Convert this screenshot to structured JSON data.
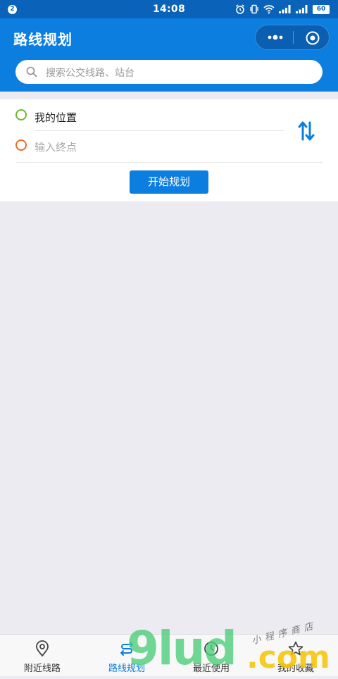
{
  "status_bar": {
    "notification_count": "2",
    "time": "14:08",
    "battery": "60"
  },
  "header": {
    "title": "路线规划"
  },
  "search": {
    "placeholder": "搜索公交线路、站台"
  },
  "route": {
    "start_label": "我的位置",
    "end_placeholder": "输入终点",
    "plan_button": "开始规划"
  },
  "colors": {
    "brand": "#0b7ee0",
    "start": "#6aba2b",
    "end": "#f06a26",
    "background": "#ebebf1"
  },
  "tabs": [
    {
      "label": "附近线路",
      "icon": "location-pin-icon",
      "active": false
    },
    {
      "label": "路线规划",
      "icon": "route-icon",
      "active": true
    },
    {
      "label": "最近使用",
      "icon": "clock-icon",
      "active": false
    },
    {
      "label": "我的收藏",
      "icon": "star-icon",
      "active": false
    }
  ],
  "watermark": {
    "brand": "9lud",
    "suffix": ".com",
    "tagline": "小程序商店"
  }
}
